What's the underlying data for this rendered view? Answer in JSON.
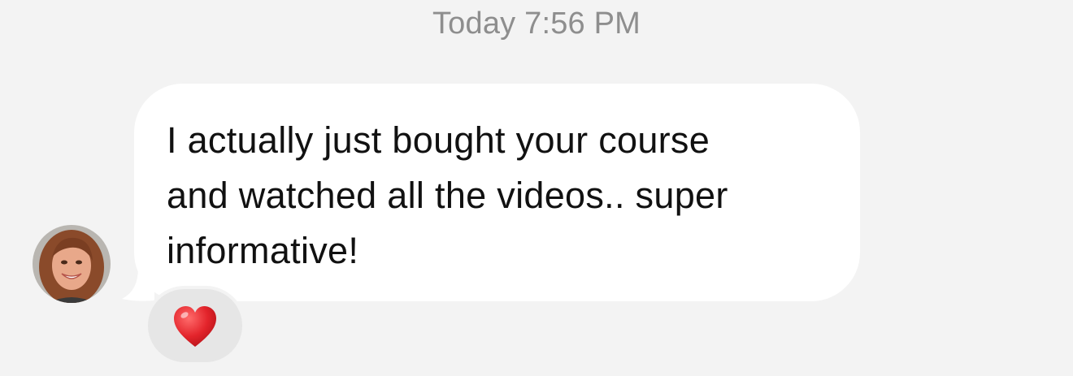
{
  "conversation": {
    "timestamp": "Today 7:56 PM"
  },
  "message": {
    "lines": [
      "I actually just bought your course",
      "and watched all the videos.. super",
      "informative!"
    ],
    "bubble_color": "#ffffff",
    "reaction": {
      "icon": "red-heart-icon",
      "color": "#e3242b"
    }
  },
  "avatar": {
    "icon": "user-avatar"
  },
  "colors": {
    "background": "#f3f3f3",
    "timestamp": "#8e8e8e",
    "reaction_pill": "#e6e6e6"
  }
}
